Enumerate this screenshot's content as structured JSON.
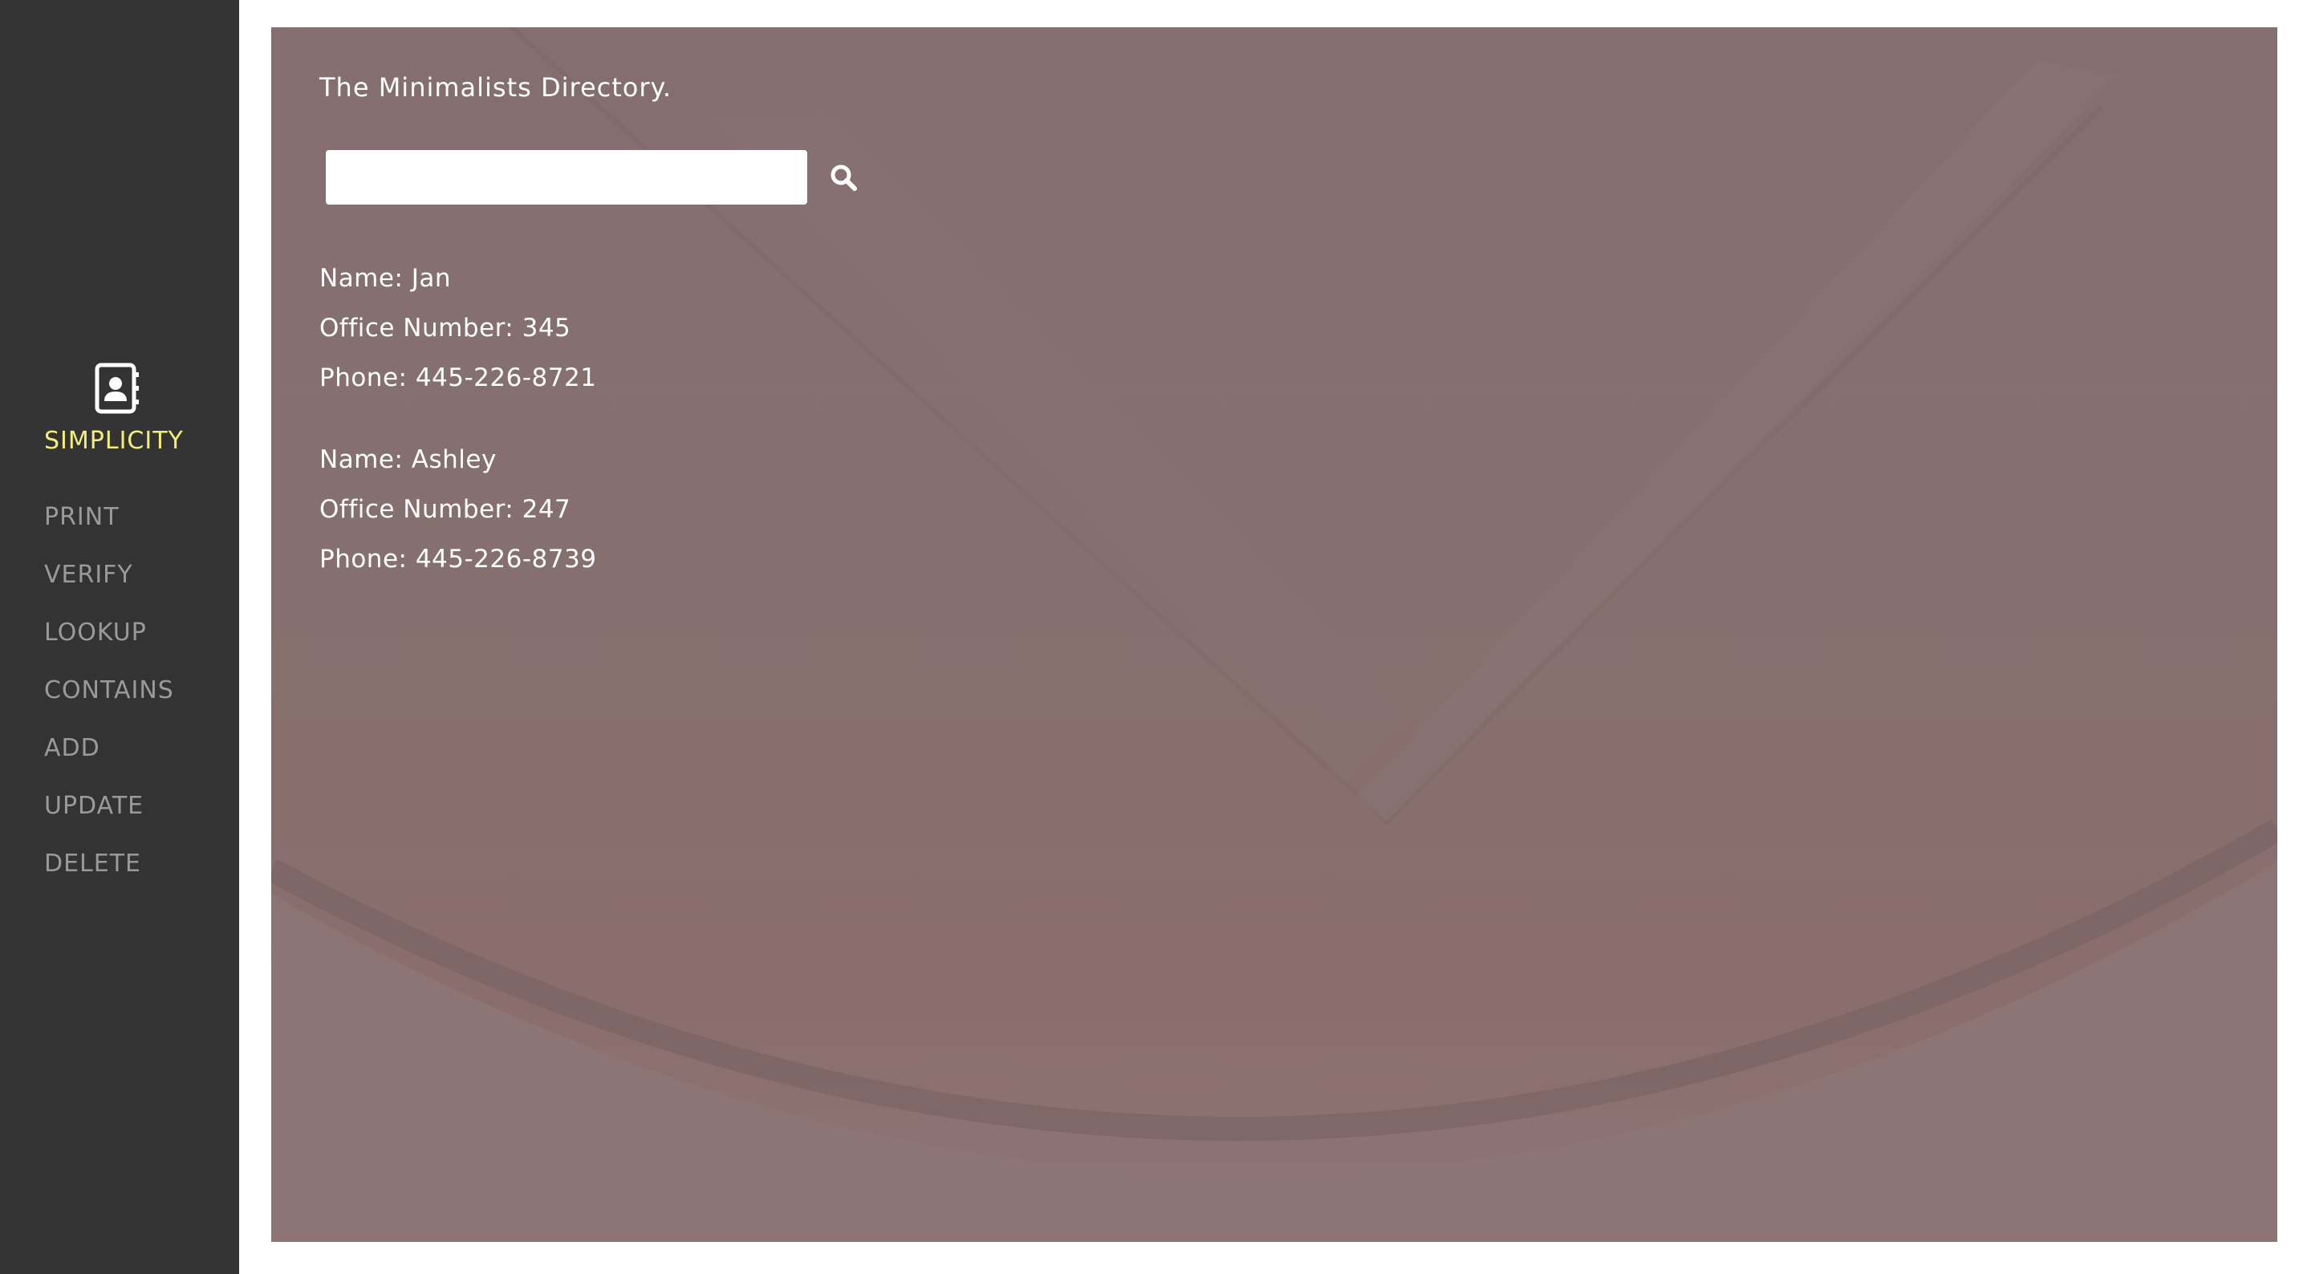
{
  "sidebar": {
    "brand": {
      "icon": "contact-book-icon",
      "label": "SIMPLICITY",
      "label_color": "#f3ef7a"
    },
    "items": [
      {
        "label": "PRINT"
      },
      {
        "label": "VERIFY"
      },
      {
        "label": "LOOKUP"
      },
      {
        "label": "CONTAINS"
      },
      {
        "label": "ADD"
      },
      {
        "label": "UPDATE"
      },
      {
        "label": "DELETE"
      }
    ]
  },
  "main": {
    "title": "The Minimalists Directory.",
    "search": {
      "value": "",
      "placeholder": "",
      "button_icon": "search-icon"
    },
    "entries": [
      {
        "name": "Name: Jan",
        "office": "Office Number: 345",
        "phone": "Phone: 445-226-8721"
      },
      {
        "name": "Name: Ashley",
        "office": "Office Number: 247",
        "phone": "Phone: 445-226-8739"
      }
    ]
  },
  "colors": {
    "sidebar_bg": "#333333",
    "nav_text": "#9a9a9a",
    "main_bg": "#86706f"
  }
}
